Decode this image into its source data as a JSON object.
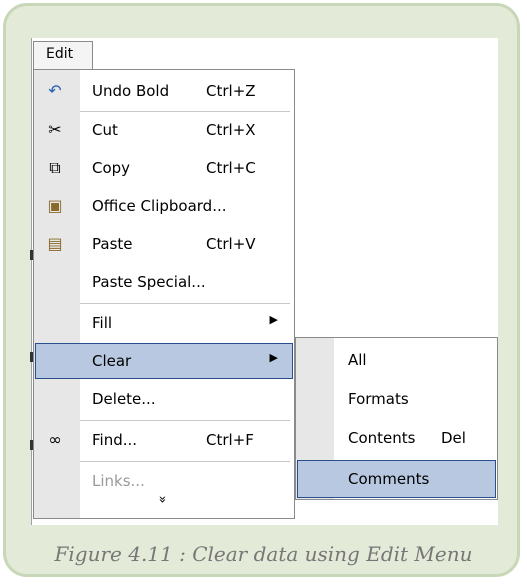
{
  "menu_bar": {
    "edit_label": "Edit"
  },
  "edit_menu": {
    "items": [
      {
        "icon": "undo-icon",
        "label": "Undo Bold",
        "shortcut": "Ctrl+Z"
      },
      {
        "icon": "scissors-icon",
        "label": "Cut",
        "shortcut": "Ctrl+X"
      },
      {
        "icon": "copy-icon",
        "label": "Copy",
        "shortcut": "Ctrl+C"
      },
      {
        "icon": "clipboard-icon",
        "label": "Office Clipboard...",
        "shortcut": ""
      },
      {
        "icon": "paste-icon",
        "label": "Paste",
        "shortcut": "Ctrl+V"
      },
      {
        "icon": "",
        "label": "Paste Special...",
        "shortcut": ""
      },
      {
        "icon": "",
        "label": "Fill",
        "shortcut": "",
        "submenu": true
      },
      {
        "icon": "",
        "label": "Clear",
        "shortcut": "",
        "submenu": true,
        "highlighted": true
      },
      {
        "icon": "",
        "label": "Delete...",
        "shortcut": ""
      },
      {
        "icon": "binoculars-icon",
        "label": "Find...",
        "shortcut": "Ctrl+F"
      },
      {
        "icon": "",
        "label": "Links...",
        "shortcut": "",
        "disabled": true
      }
    ],
    "expand_glyph": "»"
  },
  "clear_submenu": {
    "items": [
      {
        "label": "All",
        "shortcut": ""
      },
      {
        "label": "Formats",
        "shortcut": ""
      },
      {
        "label": "Contents",
        "shortcut": "Del"
      },
      {
        "label": "Comments",
        "shortcut": "",
        "highlighted": true
      }
    ]
  },
  "caption": "Figure 4.11 : Clear data using Edit Menu",
  "colors": {
    "highlight": "#b8c8e0",
    "frame": "#c9d7b9",
    "frame_bg": "#e3ead8",
    "caption": "#777777"
  }
}
